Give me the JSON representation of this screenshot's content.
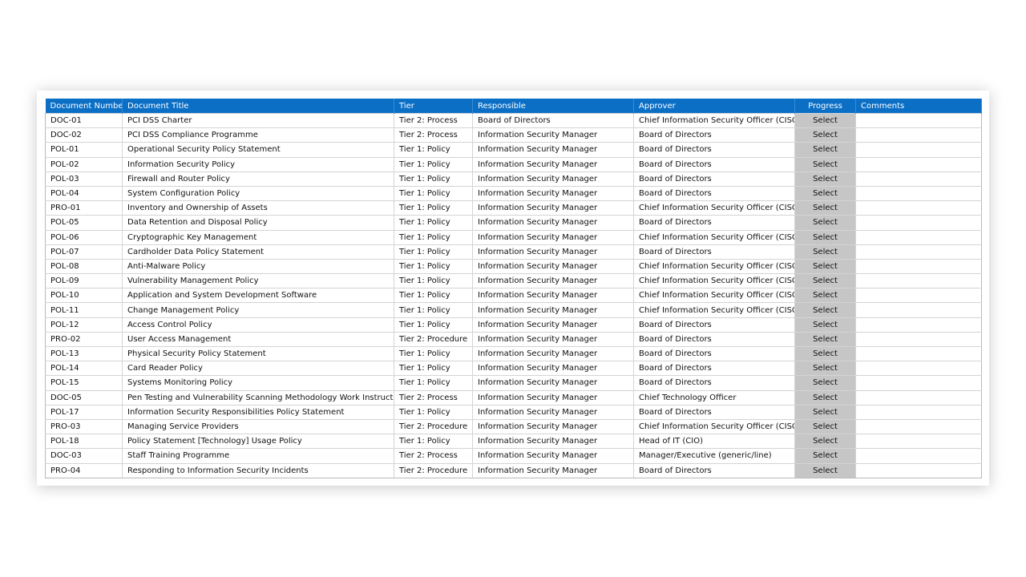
{
  "table": {
    "headers": [
      "Document Number",
      "Document Title",
      "Tier",
      "Responsible",
      "Approver",
      "Progress",
      "Comments"
    ],
    "rows": [
      [
        "DOC-01",
        "PCI DSS Charter",
        "Tier 2: Process",
        "Board of Directors",
        "Chief Information Security Officer (CISO)",
        "Select",
        ""
      ],
      [
        "DOC-02",
        "PCI DSS Compliance Programme",
        "Tier 2: Process",
        "Information Security Manager",
        "Board of Directors",
        "Select",
        ""
      ],
      [
        "POL-01",
        "Operational Security Policy Statement",
        "Tier 1: Policy",
        "Information Security Manager",
        "Board of Directors",
        "Select",
        ""
      ],
      [
        "POL-02",
        "Information Security Policy",
        "Tier 1: Policy",
        "Information Security Manager",
        "Board of Directors",
        "Select",
        ""
      ],
      [
        "POL-03",
        "Firewall and Router Policy",
        "Tier 1: Policy",
        "Information Security Manager",
        "Board of Directors",
        "Select",
        ""
      ],
      [
        "POL-04",
        "System Configuration Policy",
        "Tier 1: Policy",
        "Information Security Manager",
        "Board of Directors",
        "Select",
        ""
      ],
      [
        "PRO-01",
        "Inventory and Ownership of Assets",
        "Tier 1: Policy",
        "Information Security Manager",
        "Chief Information Security Officer (CISO)",
        "Select",
        ""
      ],
      [
        "POL-05",
        "Data Retention and Disposal Policy",
        "Tier 1: Policy",
        "Information Security Manager",
        "Board of Directors",
        "Select",
        ""
      ],
      [
        "POL-06",
        "Cryptographic Key Management",
        "Tier 1: Policy",
        "Information Security Manager",
        "Chief Information Security Officer (CISO)",
        "Select",
        ""
      ],
      [
        "POL-07",
        "Cardholder Data Policy Statement",
        "Tier 1: Policy",
        "Information Security Manager",
        "Board of Directors",
        "Select",
        ""
      ],
      [
        "POL-08",
        "Anti-Malware Policy",
        "Tier 1: Policy",
        "Information Security Manager",
        "Chief Information Security Officer (CISO)",
        "Select",
        ""
      ],
      [
        "POL-09",
        "Vulnerability Management Policy",
        "Tier 1: Policy",
        "Information Security Manager",
        "Chief Information Security Officer (CISO)",
        "Select",
        ""
      ],
      [
        "POL-10",
        "Application and System Development Software",
        "Tier 1: Policy",
        "Information Security Manager",
        "Chief Information Security Officer (CISO)",
        "Select",
        ""
      ],
      [
        "POL-11",
        "Change Management Policy",
        "Tier 1: Policy",
        "Information Security Manager",
        "Chief Information Security Officer (CISO)",
        "Select",
        ""
      ],
      [
        "POL-12",
        "Access Control Policy",
        "Tier 1: Policy",
        "Information Security Manager",
        "Board of Directors",
        "Select",
        ""
      ],
      [
        "PRO-02",
        "User Access Management",
        "Tier 2: Procedure",
        "Information Security Manager",
        "Board of Directors",
        "Select",
        ""
      ],
      [
        "POL-13",
        "Physical Security Policy Statement",
        "Tier 1: Policy",
        "Information Security Manager",
        "Board of Directors",
        "Select",
        ""
      ],
      [
        "POL-14",
        "Card Reader Policy",
        "Tier 1: Policy",
        "Information Security Manager",
        "Board of Directors",
        "Select",
        ""
      ],
      [
        "POL-15",
        "Systems Monitoring Policy",
        "Tier 1: Policy",
        "Information Security Manager",
        "Board of Directors",
        "Select",
        ""
      ],
      [
        "DOC-05",
        "Pen Testing  and Vulnerability Scanning Methodology Work Instruction",
        "Tier 2: Process",
        "Information Security Manager",
        "Chief Technology Officer",
        "Select",
        ""
      ],
      [
        "POL-17",
        "Information Security Responsibilities Policy Statement",
        "Tier 1: Policy",
        "Information Security Manager",
        "Board of Directors",
        "Select",
        ""
      ],
      [
        "PRO-03",
        "Managing Service Providers",
        "Tier 2: Procedure",
        "Information Security Manager",
        "Chief Information Security Officer (CISO)",
        "Select",
        ""
      ],
      [
        "POL-18",
        "Policy Statement [Technology] Usage Policy",
        "Tier 1: Policy",
        "Information Security Manager",
        "Head of IT (CIO)",
        "Select",
        ""
      ],
      [
        "DOC-03",
        "Staff Training Programme",
        "Tier 2: Process",
        "Information Security Manager",
        "Manager/Executive (generic/line)",
        "Select",
        ""
      ],
      [
        "PRO-04",
        "Responding to Information Security Incidents",
        "Tier 2: Procedure",
        "Information Security Manager",
        "Board of Directors",
        "Select",
        ""
      ]
    ]
  },
  "colors": {
    "header_bg": "#0b6fc6",
    "header_text": "#ffffff",
    "progress_bg": "#c6c6c6"
  }
}
